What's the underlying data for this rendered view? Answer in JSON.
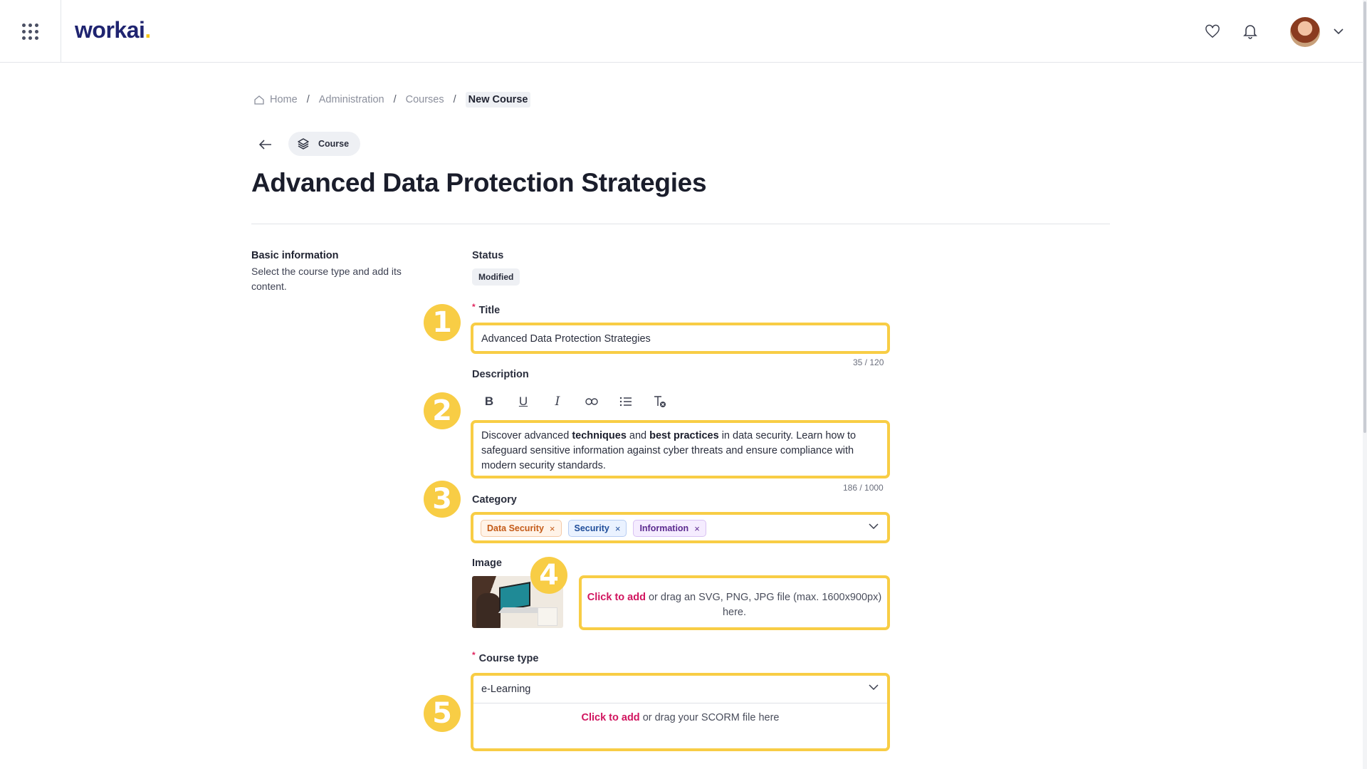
{
  "app": {
    "logo_text": "workai",
    "logo_dot": "."
  },
  "header": {
    "apps_icon": "apps-grid-icon",
    "favorites_icon": "heart-icon",
    "notifications_icon": "bell-icon",
    "profile_menu_icon": "chevron-down-icon"
  },
  "breadcrumb": {
    "items": [
      "Home",
      "Administration",
      "Courses"
    ],
    "current": "New Course",
    "separator": "/"
  },
  "course_chip": {
    "label": "Course",
    "icon": "layers-icon"
  },
  "page_title": "Advanced Data Protection Strategies",
  "section": {
    "title": "Basic information",
    "description": "Select the course type and add its content."
  },
  "status": {
    "label": "Status",
    "value": "Modified"
  },
  "title_field": {
    "label": "Title",
    "required_mark": "*",
    "value": "Advanced Data Protection Strategies",
    "counter": "35 / 120"
  },
  "description_field": {
    "label": "Description",
    "toolbar": {
      "bold": "B",
      "underline": "U",
      "italic": "I"
    },
    "text": {
      "p1": "Discover advanced ",
      "b1": "techniques",
      "p2": " and ",
      "b2": "best practices",
      "p3": " in data security. Learn how to safeguard sensitive information against cyber threats and ensure compliance with modern security standards."
    },
    "counter": "186 / 1000"
  },
  "category_field": {
    "label": "Category",
    "tags": [
      {
        "label": "Data Security",
        "color": "#c45a17"
      },
      {
        "label": "Security",
        "color": "#1f4d9a"
      },
      {
        "label": "Information",
        "color": "#5b2a8f"
      }
    ],
    "remove_glyph": "×"
  },
  "image_field": {
    "label": "Image",
    "drop_link": "Click to add",
    "drop_text": " or drag an SVG, PNG, JPG file (max. 1600x900px) here."
  },
  "course_type_field": {
    "label": "Course type",
    "required_mark": "*",
    "value": "e-Learning",
    "scorm_link": "Click to add",
    "scorm_text": " or drag your SCORM file here"
  },
  "steps": [
    "1",
    "2",
    "3",
    "4",
    "5"
  ],
  "colors": {
    "highlight": "#f8cd45",
    "link": "#d1155f",
    "brand": "#1f2470"
  }
}
